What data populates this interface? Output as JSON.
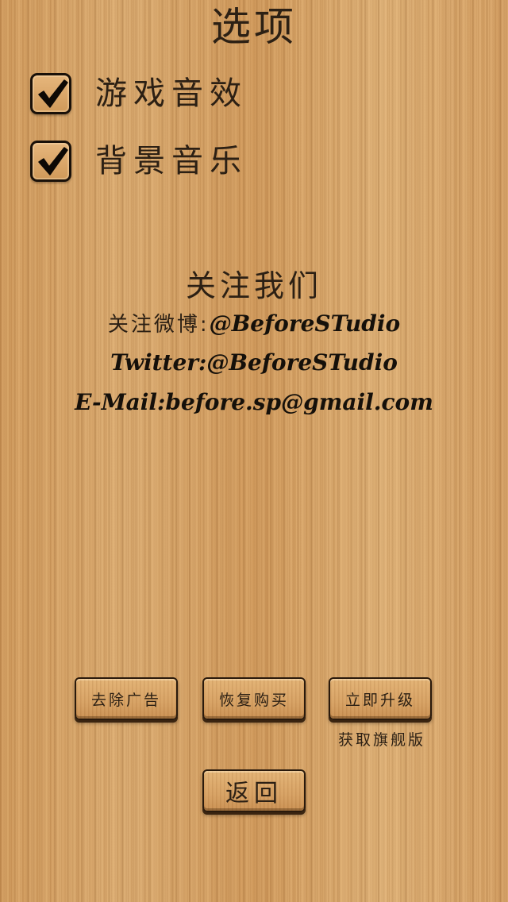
{
  "header": {
    "title": "选项"
  },
  "options": [
    {
      "label": "游戏音效",
      "checked": true,
      "icon": "checkmark-icon"
    },
    {
      "label": "背景音乐",
      "checked": true,
      "icon": "checkmark-icon"
    }
  ],
  "follow": {
    "title": "关注我们",
    "weibo_label": "关注微博:",
    "weibo_handle": "@BeforeSTudio",
    "twitter": "Twitter:@BeforeSTudio",
    "email": "E-Mail:before.sp@gmail.com"
  },
  "actions": {
    "remove_ads": "去除广告",
    "restore_purchase": "恢复购买",
    "upgrade_now": "立即升级",
    "upgrade_note": "获取旗舰版",
    "back": "返回"
  },
  "colors": {
    "wood_base": "#d8a66a",
    "text_dark": "#2c2014",
    "border_dark": "#1a1109"
  }
}
